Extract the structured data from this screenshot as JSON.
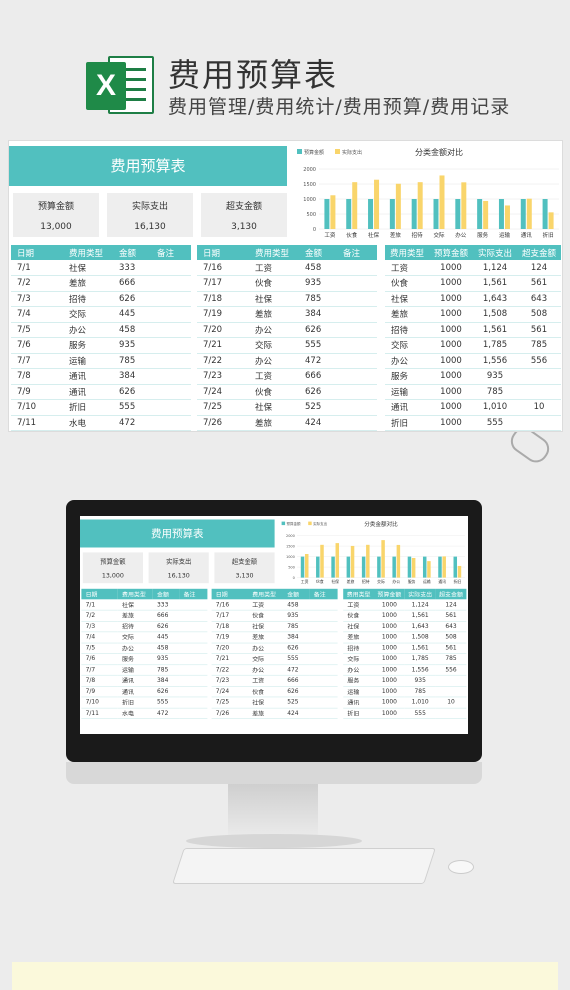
{
  "banner": {
    "title": "费用预算表",
    "subtitle": "费用管理/费用统计/费用预算/费用记录",
    "icon": "excel-icon",
    "icon_letter": "X"
  },
  "sheet": {
    "title": "费用预算表",
    "stats": [
      {
        "label": "预算金额",
        "value": "13,000"
      },
      {
        "label": "实际支出",
        "value": "16,130"
      },
      {
        "label": "超支金额",
        "value": "3,130"
      }
    ],
    "ledger_headers": [
      "日期",
      "费用类型",
      "金额",
      "备注"
    ],
    "ledger_left": [
      [
        "7/1",
        "社保",
        "333"
      ],
      [
        "7/2",
        "差旅",
        "666"
      ],
      [
        "7/3",
        "招待",
        "626"
      ],
      [
        "7/4",
        "交际",
        "445"
      ],
      [
        "7/5",
        "办公",
        "458"
      ],
      [
        "7/6",
        "服务",
        "935"
      ],
      [
        "7/7",
        "运输",
        "785"
      ],
      [
        "7/8",
        "通讯",
        "384"
      ],
      [
        "7/9",
        "通讯",
        "626"
      ],
      [
        "7/10",
        "折旧",
        "555"
      ],
      [
        "7/11",
        "水电",
        "472"
      ]
    ],
    "ledger_right": [
      [
        "7/16",
        "工资",
        "458"
      ],
      [
        "7/17",
        "伙食",
        "935"
      ],
      [
        "7/18",
        "社保",
        "785"
      ],
      [
        "7/19",
        "差旅",
        "384"
      ],
      [
        "7/20",
        "办公",
        "626"
      ],
      [
        "7/21",
        "交际",
        "555"
      ],
      [
        "7/22",
        "办公",
        "472"
      ],
      [
        "7/23",
        "工资",
        "666"
      ],
      [
        "7/24",
        "伙食",
        "626"
      ],
      [
        "7/25",
        "社保",
        "525"
      ],
      [
        "7/26",
        "差旅",
        "424"
      ]
    ],
    "summary_headers": [
      "费用类型",
      "预算金额",
      "实际支出",
      "超支金额"
    ],
    "summary": [
      [
        "工资",
        "1000",
        "1,124",
        "124"
      ],
      [
        "伙食",
        "1000",
        "1,561",
        "561"
      ],
      [
        "社保",
        "1000",
        "1,643",
        "643"
      ],
      [
        "差旅",
        "1000",
        "1,508",
        "508"
      ],
      [
        "招待",
        "1000",
        "1,561",
        "561"
      ],
      [
        "交际",
        "1000",
        "1,785",
        "785"
      ],
      [
        "办公",
        "1000",
        "1,556",
        "556"
      ],
      [
        "服务",
        "1000",
        "935",
        ""
      ],
      [
        "运输",
        "1000",
        "785",
        ""
      ],
      [
        "通讯",
        "1000",
        "1,010",
        "10"
      ],
      [
        "折旧",
        "1000",
        "555",
        ""
      ]
    ]
  },
  "colors": {
    "teal": "#51c0bf",
    "yellow": "#f9d56b",
    "over": "#e53935"
  },
  "chart_data": {
    "type": "bar",
    "title": "分类金额对比",
    "categories": [
      "工资",
      "伙食",
      "社保",
      "差旅",
      "招待",
      "交际",
      "办公",
      "服务",
      "运输",
      "通讯",
      "折旧"
    ],
    "series": [
      {
        "name": "预算金额",
        "values": [
          1000,
          1000,
          1000,
          1000,
          1000,
          1000,
          1000,
          1000,
          1000,
          1000,
          1000
        ]
      },
      {
        "name": "实际支出",
        "values": [
          1124,
          1561,
          1643,
          1508,
          1561,
          1785,
          1556,
          935,
          785,
          1010,
          555
        ]
      }
    ],
    "yticks": [
      "0",
      "500",
      "1000",
      "1500",
      "2000"
    ],
    "ylim": [
      0,
      2000
    ],
    "legend": "top-left"
  }
}
